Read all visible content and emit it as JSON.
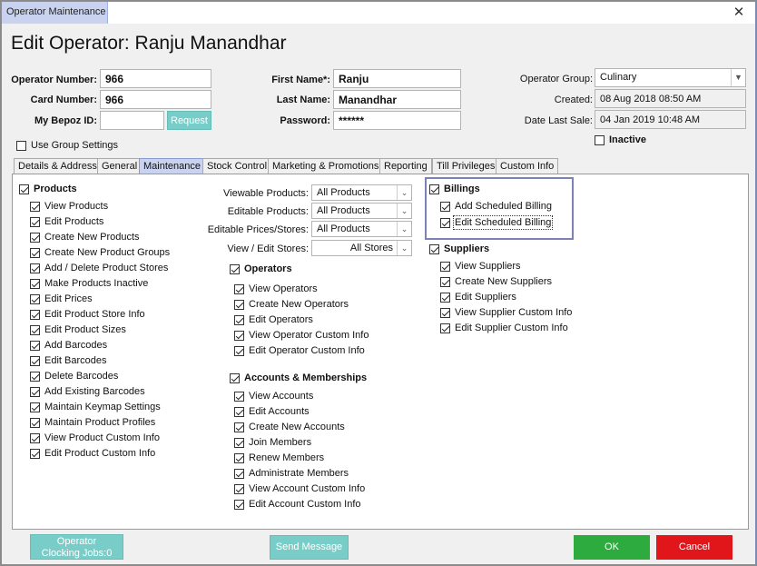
{
  "window": {
    "title": "Operator Maintenance",
    "close_glyph": "✕"
  },
  "heading": "Edit Operator: Ranju Manandhar",
  "form": {
    "operator_number_label": "Operator Number:",
    "operator_number": "966",
    "card_number_label": "Card Number:",
    "card_number": "966",
    "bepoz_id_label": "My Bepoz ID:",
    "bepoz_id": "",
    "request_label": "Request",
    "first_name_label": "First Name*:",
    "first_name": "Ranju",
    "last_name_label": "Last Name:",
    "last_name": "Manandhar",
    "password_label": "Password:",
    "password": "******",
    "operator_group_label": "Operator Group:",
    "operator_group": "Culinary",
    "created_label": "Created:",
    "created": "08 Aug 2018 08:50 AM",
    "last_sale_label": "Date Last Sale:",
    "last_sale": "04 Jan 2019 10:48 AM",
    "inactive_label": "Inactive",
    "use_group_label": "Use Group Settings"
  },
  "tabs": [
    "Details & Address",
    "General",
    "Maintenance",
    "Stock Control",
    "Marketing & Promotions",
    "Reporting",
    "Till Privileges",
    "Custom Info"
  ],
  "products": {
    "title": "Products",
    "items": [
      "View Products",
      "Edit Products",
      "Create New Products",
      "Create New Product Groups",
      "Add / Delete Product Stores",
      "Make Products Inactive",
      "Edit Prices",
      "Edit Product Store Info",
      "Edit Product Sizes",
      "Add Barcodes",
      "Edit Barcodes",
      "Delete Barcodes",
      "Add Existing Barcodes",
      "Maintain Keymap Settings",
      "Maintain Product Profiles",
      "View Product Custom Info",
      "Edit Product Custom Info"
    ]
  },
  "dropdowns": [
    {
      "label": "Viewable Products:",
      "value": "All Products"
    },
    {
      "label": "Editable Products:",
      "value": "All Products"
    },
    {
      "label": "Editable Prices/Stores:",
      "value": "All Products"
    },
    {
      "label": "View / Edit Stores:",
      "value": "All Stores"
    }
  ],
  "operators": {
    "title": "Operators",
    "items": [
      "View Operators",
      "Create New Operators",
      "Edit Operators",
      "View Operator Custom Info",
      "Edit Operator Custom Info"
    ]
  },
  "accounts": {
    "title": "Accounts & Memberships",
    "items": [
      "View Accounts",
      "Edit Accounts",
      "Create New Accounts",
      "Join Members",
      "Renew Members",
      "Administrate Members",
      "View Account Custom Info",
      "Edit Account Custom Info"
    ]
  },
  "billings": {
    "title": "Billings",
    "items": [
      "Add Scheduled Billing",
      "Edit Scheduled Billing"
    ]
  },
  "suppliers": {
    "title": "Suppliers",
    "items": [
      "View Suppliers",
      "Create New Suppliers",
      "Edit Suppliers",
      "View Supplier Custom Info",
      "Edit Supplier Custom Info"
    ]
  },
  "footer": {
    "clocking_line1": "Operator",
    "clocking_line2": "Clocking Jobs:0",
    "send_message": "Send Message",
    "ok": "OK",
    "cancel": "Cancel"
  },
  "colors": {
    "accent_teal": "#79cdc8",
    "ok_green": "#2eab3e",
    "cancel_red": "#e0161b",
    "tab_active": "#c9d3f0"
  }
}
